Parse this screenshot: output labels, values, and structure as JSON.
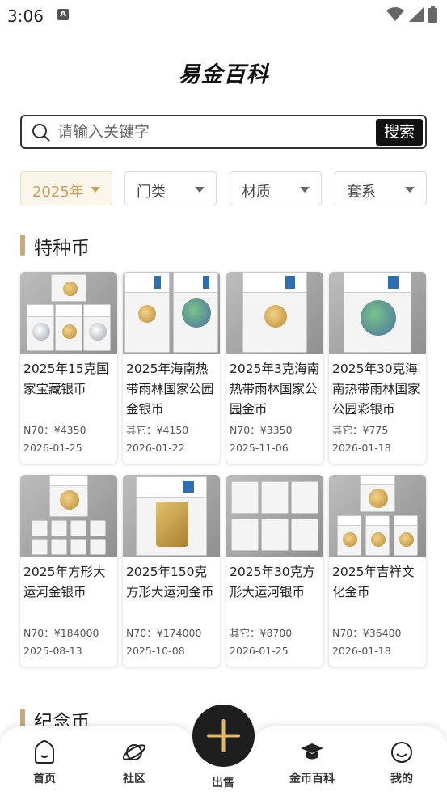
{
  "status_bar": {
    "time": "3:06",
    "notification_icon": "A"
  },
  "title": "易金百科",
  "search": {
    "placeholder": "请输入关键字",
    "button_label": "搜索"
  },
  "filters": [
    {
      "label": "2025年",
      "active": true
    },
    {
      "label": "门类",
      "active": false
    },
    {
      "label": "材质",
      "active": false
    },
    {
      "label": "套系",
      "active": false
    }
  ],
  "sections": [
    {
      "title": "特种币",
      "rows": [
        [
          {
            "name": "2025年15克国家宝藏银币",
            "price": "N70：¥4350",
            "date": "2026-01-25"
          },
          {
            "name": "2025年海南热带雨林国家公园金银币",
            "price": "其它：¥4150",
            "date": "2026-01-22"
          },
          {
            "name": "2025年3克海南热带雨林国家公园金币",
            "price": "N70：¥3350",
            "date": "2025-11-06"
          },
          {
            "name": "2025年30克海南热带雨林国家公园彩银币",
            "price": "其它：¥775",
            "date": "2026-01-18"
          }
        ],
        [
          {
            "name": "2025年方形大运河金银币",
            "price": "N70：¥184000",
            "date": "2025-08-13"
          },
          {
            "name": "2025年150克方形大运河金币",
            "price": "N70：¥174000",
            "date": "2025-10-08"
          },
          {
            "name": "2025年30克方形大运河银币",
            "price": "其它：¥8700",
            "date": "2026-01-25"
          },
          {
            "name": "2025年吉祥文化金币",
            "price": "N70：¥36400",
            "date": "2026-01-18"
          }
        ]
      ]
    },
    {
      "title": "纪念币"
    }
  ],
  "bottom_nav": {
    "items": [
      {
        "label": "首页",
        "icon": "home-icon"
      },
      {
        "label": "社区",
        "icon": "planet-icon"
      },
      {
        "label": "出售",
        "icon": "plus-icon"
      },
      {
        "label": "金币百科",
        "icon": "graduation-cap-icon"
      },
      {
        "label": "我的",
        "icon": "smiley-icon"
      }
    ]
  },
  "colors": {
    "accent": "#c9a15a",
    "section_bar": "#c9a87a",
    "dark": "#1e1e1e"
  }
}
